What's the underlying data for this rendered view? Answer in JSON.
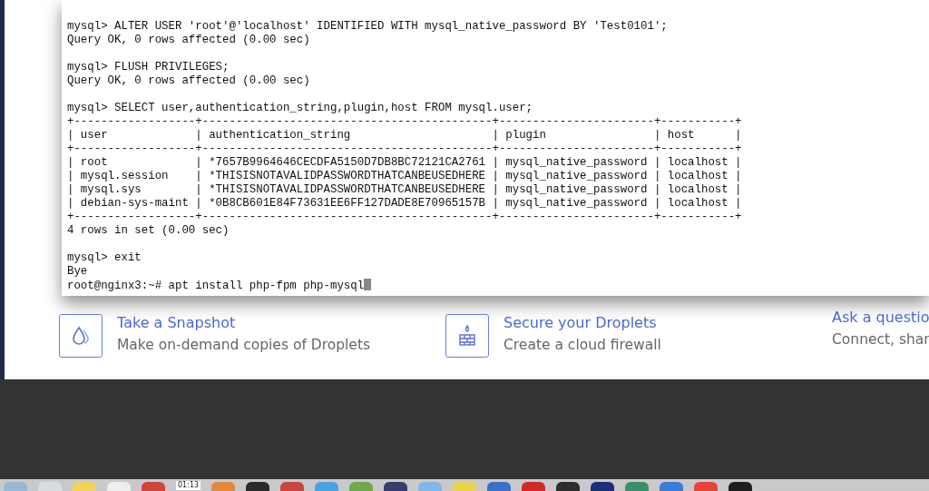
{
  "terminal": {
    "blocks": [
      [
        "mysql> ALTER USER 'root'@'localhost' IDENTIFIED WITH mysql_native_password BY 'Test0101';",
        "Query OK, 0 rows affected (0.00 sec)"
      ],
      [
        "mysql> FLUSH PRIVILEGES;",
        "Query OK, 0 rows affected (0.00 sec)"
      ],
      [
        "mysql> SELECT user,authentication_string,plugin,host FROM mysql.user;",
        "+------------------+-------------------------------------------+-----------------------+-----------+",
        "| user             | authentication_string                     | plugin                | host      |",
        "+------------------+-------------------------------------------+-----------------------+-----------+",
        "| root             | *7657B9964646CECDFA5150D7DB8BC72121CA2761 | mysql_native_password | localhost |",
        "| mysql.session    | *THISISNOTAVALIDPASSWORDTHATCANBEUSEDHERE | mysql_native_password | localhost |",
        "| mysql.sys        | *THISISNOTAVALIDPASSWORDTHATCANBEUSEDHERE | mysql_native_password | localhost |",
        "| debian-sys-maint | *0B8CB601E84F73631EE6FF127DADE8E70965157B | mysql_native_password | localhost |",
        "+------------------+-------------------------------------------+-----------------------+-----------+",
        "4 rows in set (0.00 sec)"
      ],
      [
        "mysql> exit",
        "Bye",
        "root@nginx3:~# apt install php-fpm php-mysql"
      ]
    ]
  },
  "features": [
    {
      "kind": "snapshot",
      "title": "Take a Snapshot",
      "subtitle": "Make on-demand copies of Droplets"
    },
    {
      "kind": "firewall",
      "title": "Secure your Droplets",
      "subtitle": "Create a cloud firewall"
    },
    {
      "kind": "none",
      "title": "Ask a questio",
      "subtitle": "Connect, shar"
    }
  ],
  "dock": {
    "clock": "01:13"
  }
}
